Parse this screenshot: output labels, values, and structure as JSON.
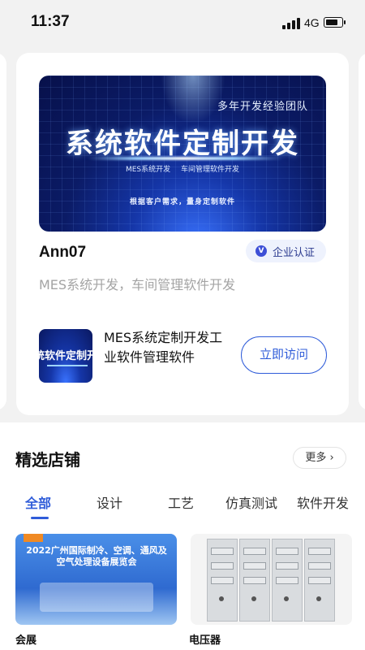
{
  "status_bar": {
    "time": "11:37",
    "network": "4G",
    "battery_level": 0.8
  },
  "shop_card": {
    "banner": {
      "subtitle": "多年开发经验团队",
      "title": "系统软件定制开发",
      "tags": [
        "MES系统开发",
        "车间管理软件开发"
      ],
      "slogan": "根据客户需求，量身定制软件"
    },
    "name": "Ann07",
    "badge_icon": "V",
    "badge_label": "企业认证",
    "description": "MES系统开发，车间管理软件开发",
    "product": {
      "thumb_text": "统软件定制开发",
      "title": "MES系统定制开发工业软件管理软件",
      "visit_label": "立即访问"
    }
  },
  "featured": {
    "title": "精选店铺",
    "more_label": "更多",
    "tabs": [
      "全部",
      "设计",
      "工艺",
      "仿真测试",
      "软件开发"
    ],
    "active_tab": "全部",
    "stores": [
      {
        "label": "会展",
        "image_text": "2022广州国际制冷、空调、通风及空气处理设备展览会"
      },
      {
        "label": "电压器"
      }
    ]
  },
  "colors": {
    "accent": "#2f5cd9",
    "page_bg": "#f2f2f2",
    "muted_text": "#a4a4a4"
  }
}
